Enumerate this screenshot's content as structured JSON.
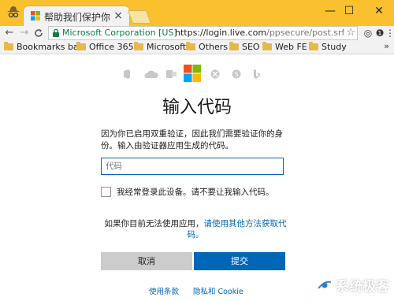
{
  "browser": {
    "tab_title": "帮助我们保护你的帐",
    "tab_close": "×",
    "window": {
      "minimize": "—",
      "maximize": "☐",
      "close": "✕"
    },
    "nav": {
      "back": "←",
      "forward": "→",
      "reload": "C"
    },
    "ev_name": "Microsoft Corporation [US]",
    "url_host": "https://login.live.com",
    "url_path": "/ppsecure/post.srf?w",
    "bookmark_star": "☆",
    "toolbar_icons": {
      "extension": "◎",
      "info": "❶",
      "menu": "⋮"
    },
    "bookmarks": [
      "Bookmarks bar",
      "Office 365",
      "Microsoft",
      "Others",
      "SEO",
      "Web FE",
      "Study"
    ],
    "bookmarks_more": "»"
  },
  "page": {
    "brand_colors": {
      "red": "#f25022",
      "green": "#7fba00",
      "blue": "#00a4ef",
      "yellow": "#ffb900"
    },
    "heading": "输入代码",
    "description": "因为你已启用双重验证，因此我们需要验证你的身份。输入由验证器应用生成的代码。",
    "code_placeholder": "代码",
    "remember_label": "我经常登录此设备。请不要让我输入代码。",
    "alt_prefix": "如果你目前无法使用应用，",
    "alt_link": "请使用其他方法获取代码。",
    "cancel_label": "取消",
    "submit_label": "提交",
    "terms_link": "使用条款",
    "privacy_link": "隐私和 Cookie"
  },
  "watermark": {
    "text": "系统极客"
  },
  "colors": {
    "titlebar": "#fbc02d",
    "accent": "#0067b8",
    "ev_green": "#0b8043"
  }
}
